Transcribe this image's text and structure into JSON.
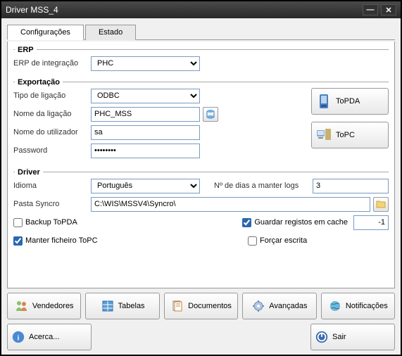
{
  "window": {
    "title": "Driver MSS_4"
  },
  "tabs": {
    "config": "Configurações",
    "estado": "Estado"
  },
  "erp": {
    "group": "ERP",
    "integration_label": "ERP de integração",
    "integration_value": "PHC"
  },
  "export": {
    "group": "Exportação",
    "conn_type_label": "Tipo de ligação",
    "conn_type_value": "ODBC",
    "conn_name_label": "Nome da ligação",
    "conn_name_value": "PHC_MSS",
    "user_label": "Nome do utilizador",
    "user_value": "sa",
    "pass_label": "Password",
    "pass_value": "••••••••",
    "topda": "ToPDA",
    "topc": "ToPC"
  },
  "driver": {
    "group": "Driver",
    "lang_label": "Idioma",
    "lang_value": "Português",
    "days_label": "Nº de dias a manter logs",
    "days_value": "3",
    "folder_label": "Pasta Syncro",
    "folder_value": "C:\\WIS\\MSSV4\\Syncro\\",
    "backup_topda": "Backup ToPDA",
    "guardar_cache": "Guardar registos em cache",
    "cache_value": "-1",
    "manter_topc": "Manter ficheiro ToPC",
    "forcar_escrita": "Forçar escrita"
  },
  "buttons": {
    "vendedores": "Vendedores",
    "tabelas": "Tabelas",
    "documentos": "Documentos",
    "avancadas": "Avançadas",
    "notificacoes": "Notificações",
    "acerca": "Acerca...",
    "sair": "Sair"
  }
}
